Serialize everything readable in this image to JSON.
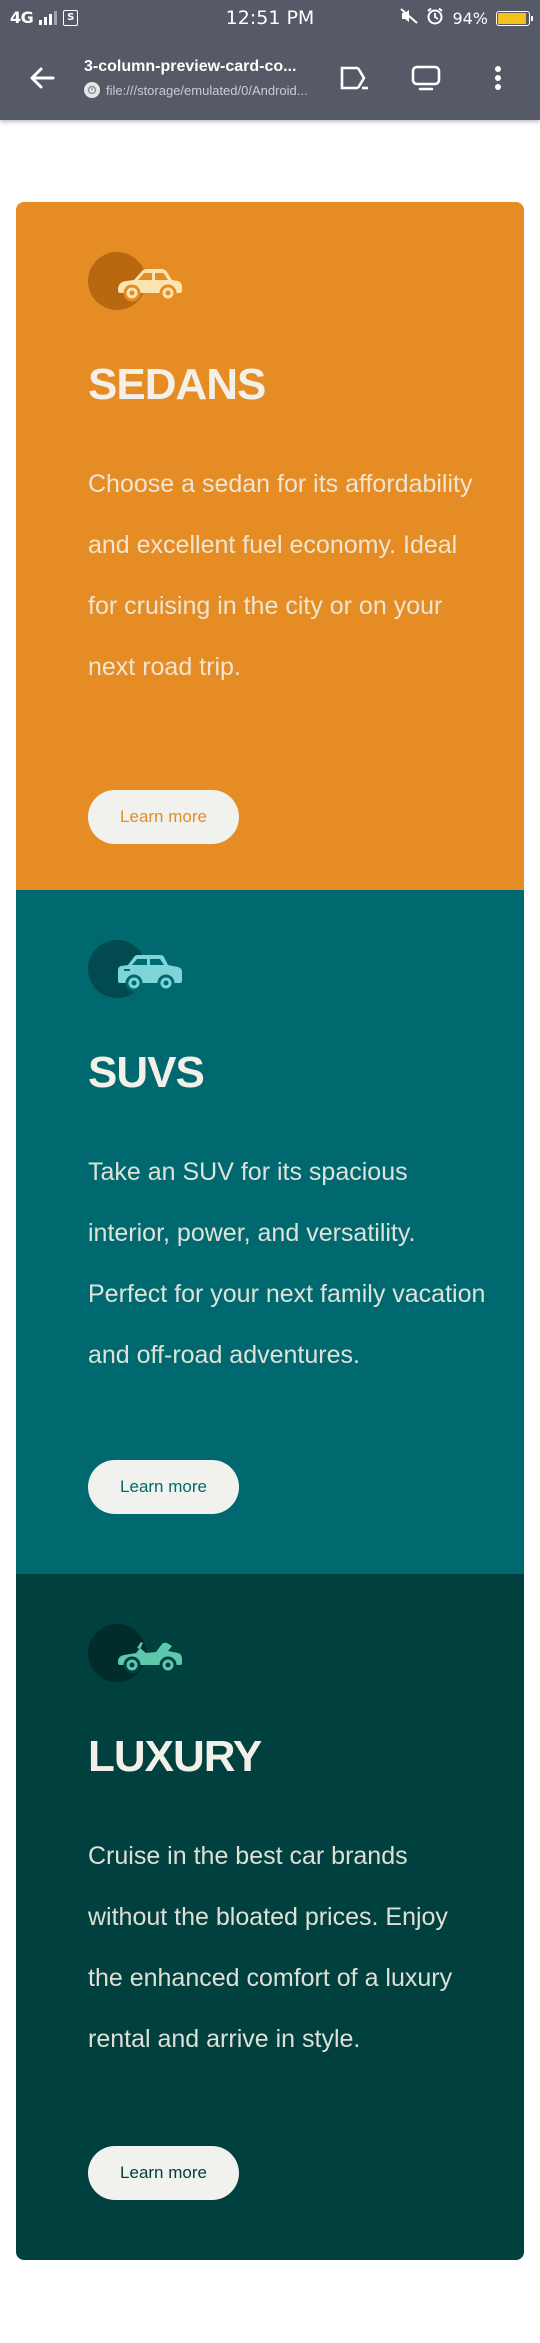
{
  "status_bar": {
    "network": "4G",
    "time": "12:51 PM",
    "battery_percent": "94%",
    "battery_level": 0.94,
    "sim_label": "S",
    "icons": [
      "signal-bars-icon",
      "sim-icon",
      "mute-icon",
      "alarm-icon",
      "battery-icon"
    ]
  },
  "toolbar": {
    "page_title": "3-column-preview-card-co...",
    "url": "file:///storage/emulated/0/Android...",
    "icons": [
      "back-arrow-icon",
      "lock-icon",
      "share-icon",
      "tabs-icon",
      "overflow-menu-icon"
    ]
  },
  "cards": [
    {
      "id": "sedans",
      "title": "SEDANS",
      "body": "Choose a sedan for its affordability and excellent fuel economy. Ideal for cruising in the city or on your next road trip.",
      "button": "Learn more",
      "icon": "sedan-car-icon",
      "color": "#e58c24"
    },
    {
      "id": "suvs",
      "title": "SUVS",
      "body": "Take an SUV for its spacious interior, power, and versatility. Perfect for your next family vacation and off-road adventures.",
      "button": "Learn more",
      "icon": "suv-car-icon",
      "color": "#006970"
    },
    {
      "id": "luxury",
      "title": "LUXURY",
      "body": "Cruise in the best car brands without the bloated prices. Enjoy the enhanced comfort of a luxury rental and arrive in style.",
      "button": "Learn more",
      "icon": "luxury-car-icon",
      "color": "#00403f"
    }
  ]
}
